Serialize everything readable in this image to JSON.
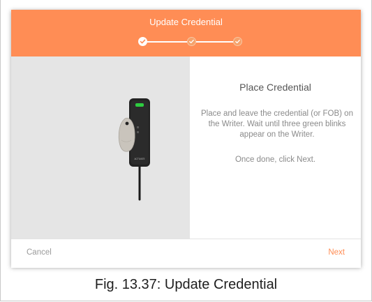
{
  "dialog": {
    "title": "Update Credential",
    "steps": [
      "completed",
      "pending",
      "pending"
    ],
    "content": {
      "title": "Place Credential",
      "instructions": "Place and leave the credential (or FOB) on the Writer. Wait until three green blinks appear on the Writer.",
      "hint": "Once done, click Next."
    },
    "footer": {
      "cancel_label": "Cancel",
      "next_label": "Next"
    }
  },
  "caption": "Fig. 13.37: Update Credential",
  "illustration": {
    "icon": "credential-writer-icon",
    "device_label": "ACTIVATE"
  },
  "colors": {
    "accent": "#ff8d55",
    "panel_gray": "#e5e5e5",
    "led_green": "#2ecc40"
  }
}
